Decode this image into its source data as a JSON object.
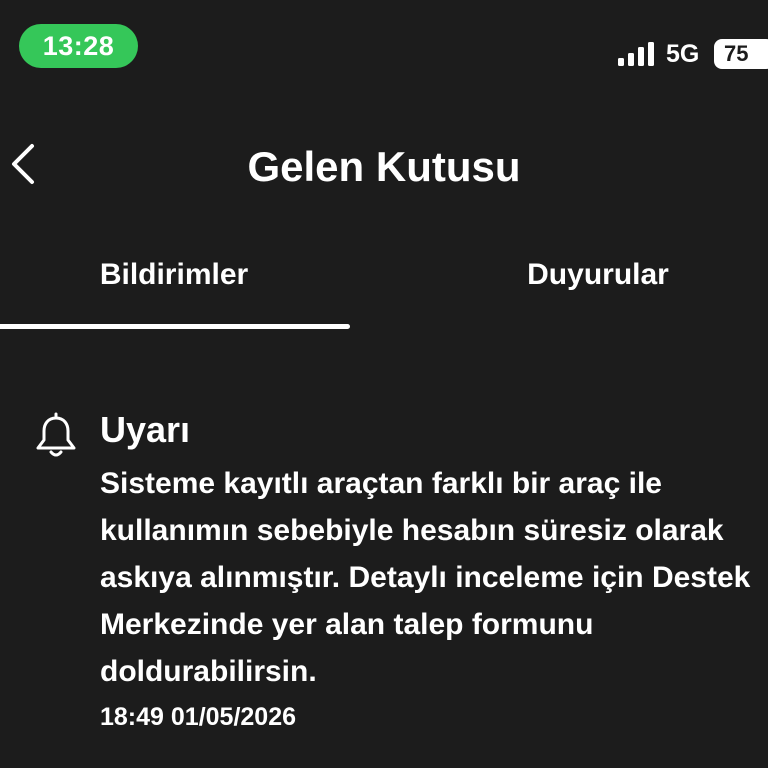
{
  "status_bar": {
    "time": "13:28",
    "network": "5G",
    "battery": "75",
    "signal_icon": "signal-bars-icon",
    "accent_color": "#35c759"
  },
  "header": {
    "title": "Gelen Kutusu",
    "back_icon": "chevron-left-icon"
  },
  "tabs": [
    {
      "label": "Bildirimler",
      "active": true
    },
    {
      "label": "Duyurular",
      "active": false
    }
  ],
  "notifications": [
    {
      "icon": "bell-icon",
      "title": "Uyarı",
      "body": "Sisteme kayıtlı araçtan farklı bir araç ile kullanımın sebebiyle hesabın süresiz olarak askıya alınmıştır. Detaylı inceleme için Destek Merkezinde yer alan talep formunu doldurabilirsin.",
      "timestamp": "18:49 01/05/2026"
    }
  ],
  "colors": {
    "background": "#1c1c1c",
    "text": "#ffffff"
  }
}
